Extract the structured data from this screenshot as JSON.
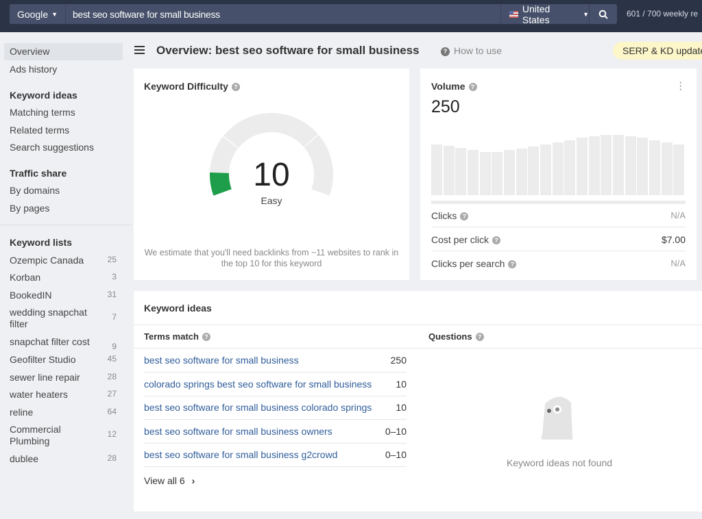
{
  "topbar": {
    "engine": "Google",
    "query": "best seo software for small business",
    "country": "United States",
    "quota": "601 / 700 weekly re"
  },
  "sidebar": {
    "overview": "Overview",
    "ads_history": "Ads history",
    "keyword_ideas": {
      "heading": "Keyword ideas",
      "items": [
        "Matching terms",
        "Related terms",
        "Search suggestions"
      ]
    },
    "traffic_share": {
      "heading": "Traffic share",
      "items": [
        "By domains",
        "By pages"
      ]
    },
    "keyword_lists": {
      "heading": "Keyword lists",
      "items": [
        {
          "name": "Ozempic Canada",
          "count": "25"
        },
        {
          "name": "Korban",
          "count": "3"
        },
        {
          "name": "BookedIN",
          "count": "31"
        },
        {
          "name": "wedding snapchat filter",
          "count": "7"
        },
        {
          "name": "snapchat filter cost",
          "count": "9"
        },
        {
          "name": "Geofilter Studio",
          "count": "45"
        },
        {
          "name": "sewer line repair",
          "count": "28"
        },
        {
          "name": "water heaters",
          "count": "27"
        },
        {
          "name": "reline",
          "count": "64"
        },
        {
          "name": "Commercial Plumbing",
          "count": "12"
        },
        {
          "name": "dublee",
          "count": "28"
        }
      ]
    }
  },
  "header": {
    "title": "Overview: best seo software for small business",
    "how_to_use": "How to use",
    "badge": "SERP & KD update"
  },
  "kd": {
    "title": "Keyword Difficulty",
    "value": "10",
    "score": 10,
    "label": "Easy",
    "note": "We estimate that you'll need backlinks from ~11 websites to rank in the top 10 for this keyword",
    "color": "#1e9e4a"
  },
  "volume": {
    "title": "Volume",
    "value": "250",
    "bars": [
      78,
      76,
      73,
      69,
      66,
      66,
      69,
      72,
      75,
      78,
      81,
      84,
      88,
      91,
      93,
      93,
      91,
      88,
      84,
      81,
      78
    ],
    "metrics": [
      {
        "label": "Clicks",
        "value": "N/A"
      },
      {
        "label": "Cost per click",
        "value": "$7.00"
      },
      {
        "label": "Clicks per search",
        "value": "N/A"
      }
    ]
  },
  "ideas": {
    "title": "Keyword ideas",
    "terms_match": "Terms match",
    "questions": "Questions",
    "rows": [
      {
        "kw": "best seo software for small business",
        "v": "250"
      },
      {
        "kw": "colorado springs best seo software for small business",
        "v": "10"
      },
      {
        "kw": "best seo software for small business colorado springs",
        "v": "10"
      },
      {
        "kw": "best seo software for small business owners",
        "v": "0–10"
      },
      {
        "kw": "best seo software for small business g2crowd",
        "v": "0–10"
      }
    ],
    "view_all": "View all 6",
    "not_found": "Keyword ideas not found"
  }
}
